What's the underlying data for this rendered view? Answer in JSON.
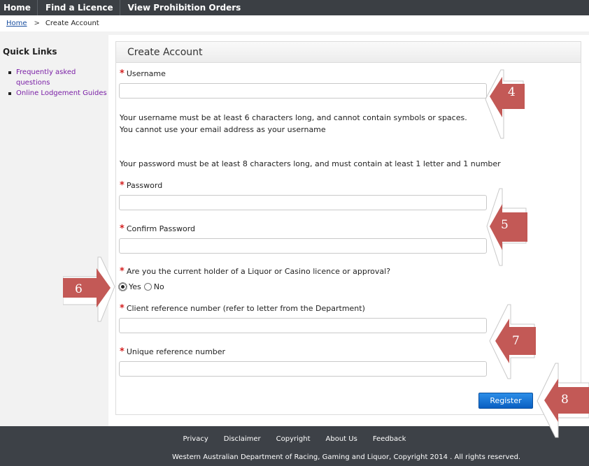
{
  "nav": {
    "items": [
      "Home",
      "Find a Licence",
      "View Prohibition Orders"
    ]
  },
  "breadcrumb": {
    "home": "Home",
    "separator": ">",
    "current": "Create Account"
  },
  "sidebar": {
    "title": "Quick Links",
    "links": [
      "Frequently asked questions",
      "Online Lodgement Guides"
    ]
  },
  "form": {
    "title": "Create Account",
    "username_label": "Username",
    "username_help_1": "Your username must be at least 6 characters long, and cannot contain symbols or spaces.",
    "username_help_2": "You cannot use your email address as your username",
    "password_help": "Your password must be at least 8 characters long, and must contain at least 1 letter and 1 number",
    "password_label": "Password",
    "confirm_label": "Confirm Password",
    "licence_question": "Are you the current holder of a Liquor or Casino licence or approval?",
    "yes_label": "Yes",
    "no_label": "No",
    "selected_option": "Yes",
    "client_ref_label": "Client reference number (refer to letter from the Department)",
    "unique_ref_label": "Unique reference number",
    "required_marker": "*",
    "register_label": "Register"
  },
  "footer": {
    "links": [
      "Privacy",
      "Disclaimer",
      "Copyright",
      "About Us",
      "Feedback"
    ],
    "copyright": "Western Australian Department of Racing, Gaming and Liquor, Copyright 2014 . All rights reserved."
  },
  "callouts": [
    "4",
    "5",
    "6",
    "7",
    "8"
  ],
  "colors": {
    "callout": "#c0504d",
    "nav": "#3b3f44",
    "required": "#d41f1f",
    "button": "#0a5fc2",
    "link": "#7a1fa6"
  }
}
